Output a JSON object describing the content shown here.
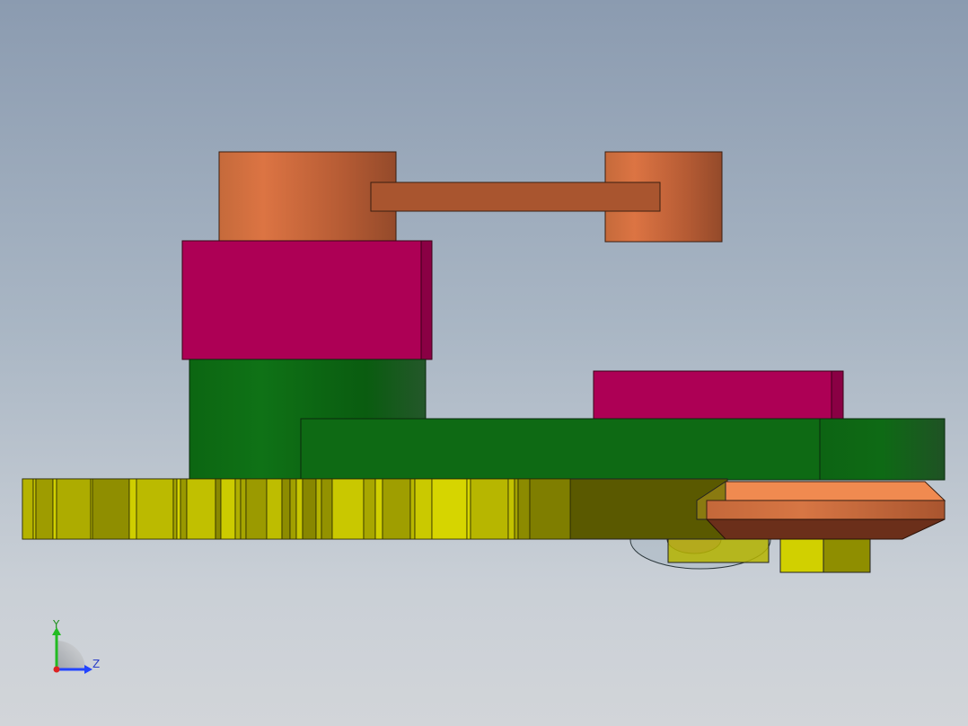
{
  "view": {
    "background_top": "#8b9bb0",
    "background_bottom": "#d2d5d9"
  },
  "parts": {
    "copper": "#d4703f",
    "copper_dark": "#a9552f",
    "magenta": "#ad0055",
    "magenta_dark": "#8a0044",
    "green": "#0e6e14",
    "green_dark": "#1b5a1e",
    "yellow": "#c8c800",
    "yellow_dark": "#5a5a00",
    "orange_plate": "#f08a50",
    "plate_bottom": "#6b2f1a",
    "purple": "#b070c0"
  },
  "triad": {
    "y_label": "Y",
    "z_label": "Z",
    "y_color": "#22bb22",
    "z_color": "#2244ff",
    "x_color": "#dd2222"
  }
}
